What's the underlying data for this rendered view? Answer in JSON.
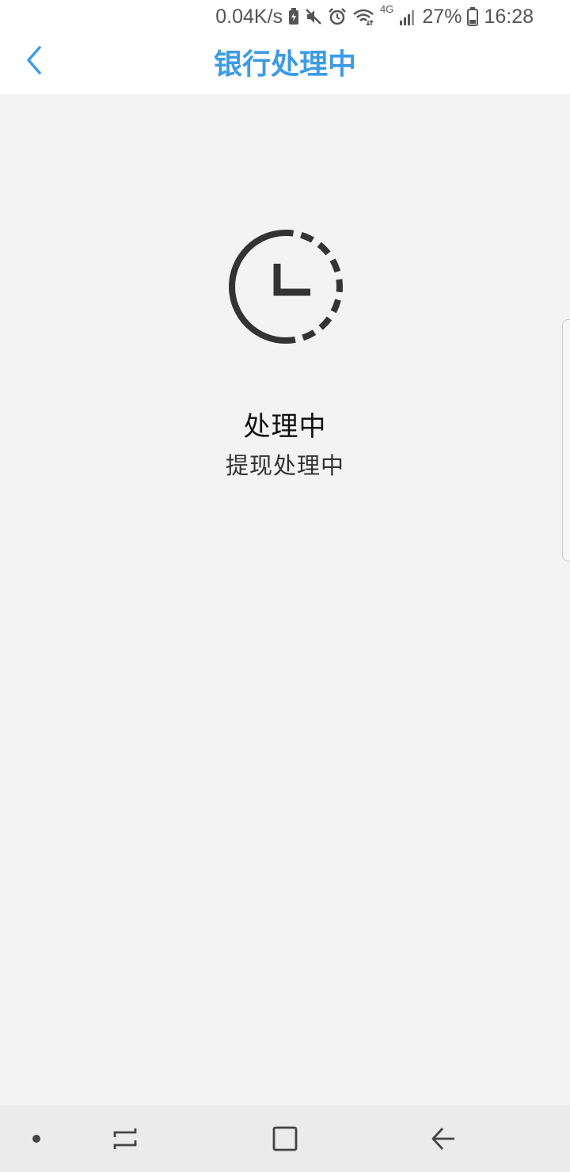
{
  "status_bar": {
    "net_speed": "0.04K/s",
    "network_type": "4G",
    "battery_percent": "27%",
    "time": "16:28",
    "icons": [
      "battery-saver-icon",
      "mute-icon",
      "alarm-icon",
      "wifi-icon",
      "signal-icon",
      "battery-icon"
    ]
  },
  "header": {
    "back_icon": "chevron-left-icon",
    "title": "银行处理中"
  },
  "main": {
    "status_icon": "clock-pending-icon",
    "status_title": "处理中",
    "status_subtitle": "提现处理中"
  },
  "nav_bar": {
    "icons": [
      "dot-icon",
      "recent-apps-icon",
      "home-icon",
      "back-arrow-icon"
    ]
  },
  "colors": {
    "accent": "#3d9be3",
    "background": "#f3f3f3",
    "header_bg": "#ffffff",
    "icon_dark": "#333333",
    "nav_bg": "#ebebeb"
  }
}
